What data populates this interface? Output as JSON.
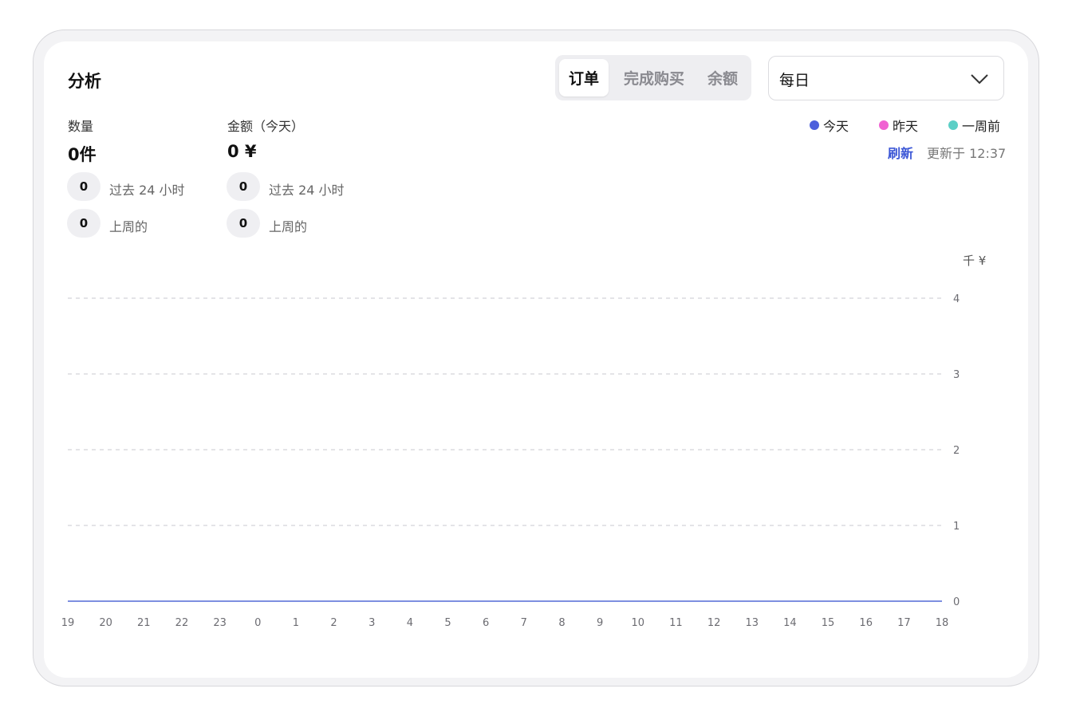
{
  "header": {
    "title": "分析",
    "tabs": [
      {
        "label": "订单",
        "active": true
      },
      {
        "label": "完成购买",
        "active": false
      },
      {
        "label": "余额",
        "active": false
      }
    ],
    "period_select": {
      "value": "每日"
    }
  },
  "stats": {
    "quantity": {
      "label": "数量",
      "value": "0件",
      "rows": [
        {
          "count": "0",
          "text": "过去 24 小时"
        },
        {
          "count": "0",
          "text": "上周的"
        }
      ]
    },
    "amount": {
      "label": "金额（今天）",
      "value": "0 ¥",
      "rows": [
        {
          "count": "0",
          "text": "过去 24 小时"
        },
        {
          "count": "0",
          "text": "上周的"
        }
      ]
    }
  },
  "legend": [
    {
      "label": "今天",
      "color": "#4d5fdc"
    },
    {
      "label": "昨天",
      "color": "#f062d2"
    },
    {
      "label": "一周前",
      "color": "#5ccfc6"
    }
  ],
  "refresh_label": "刷新",
  "updated_text": "更新于 12:37",
  "chart_data": {
    "type": "line",
    "ylabel": "千 ¥",
    "ylim": [
      0,
      4
    ],
    "yticks": [
      0,
      1,
      2,
      3,
      4
    ],
    "grid": true,
    "x": [
      "19",
      "20",
      "21",
      "22",
      "23",
      "0",
      "1",
      "2",
      "3",
      "4",
      "5",
      "6",
      "7",
      "8",
      "9",
      "10",
      "11",
      "12",
      "13",
      "14",
      "15",
      "16",
      "17",
      "18"
    ],
    "series": [
      {
        "name": "今天",
        "color": "#7d8fe0",
        "values": [
          0,
          0,
          0,
          0,
          0,
          0,
          0,
          0,
          0,
          0,
          0,
          0,
          0,
          0,
          0,
          0,
          0,
          0,
          0,
          0,
          0,
          0,
          0,
          0
        ]
      }
    ]
  }
}
